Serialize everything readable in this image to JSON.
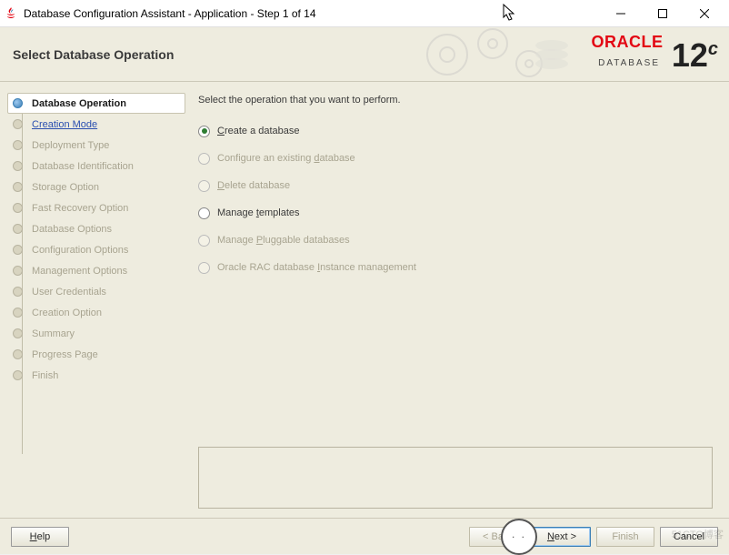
{
  "window": {
    "title": "Database Configuration Assistant - Application - Step 1 of 14"
  },
  "header": {
    "title": "Select Database Operation"
  },
  "brand": {
    "company": "ORACLE",
    "version_num": "12",
    "version_suffix": "c",
    "product": "DATABASE"
  },
  "sidebar": {
    "steps": [
      {
        "label": "Database Operation",
        "state": "active"
      },
      {
        "label": "Creation Mode",
        "state": "link"
      },
      {
        "label": "Deployment Type",
        "state": ""
      },
      {
        "label": "Database Identification",
        "state": ""
      },
      {
        "label": "Storage Option",
        "state": ""
      },
      {
        "label": "Fast Recovery Option",
        "state": ""
      },
      {
        "label": "Database Options",
        "state": ""
      },
      {
        "label": "Configuration Options",
        "state": ""
      },
      {
        "label": "Management Options",
        "state": ""
      },
      {
        "label": "User Credentials",
        "state": ""
      },
      {
        "label": "Creation Option",
        "state": ""
      },
      {
        "label": "Summary",
        "state": ""
      },
      {
        "label": "Progress Page",
        "state": ""
      },
      {
        "label": "Finish",
        "state": ""
      }
    ]
  },
  "main": {
    "instruction": "Select the operation that you want to perform.",
    "options": [
      {
        "label_pre": "",
        "key": "C",
        "label_post": "reate a database",
        "selected": true,
        "enabled": true
      },
      {
        "label_pre": "Configure an existing ",
        "key": "d",
        "label_post": "atabase",
        "selected": false,
        "enabled": false
      },
      {
        "label_pre": "",
        "key": "D",
        "label_post": "elete database",
        "selected": false,
        "enabled": false
      },
      {
        "label_pre": "Manage ",
        "key": "t",
        "label_post": "emplates",
        "selected": false,
        "enabled": true
      },
      {
        "label_pre": "Manage ",
        "key": "P",
        "label_post": "luggable databases",
        "selected": false,
        "enabled": false
      },
      {
        "label_pre": "Oracle RAC database ",
        "key": "I",
        "label_post": "nstance management",
        "selected": false,
        "enabled": false
      }
    ]
  },
  "footer": {
    "help": "Help",
    "back": "< Back",
    "next": "Next >",
    "finish": "Finish",
    "cancel": "Cancel"
  },
  "watermark": "51CTO博客"
}
